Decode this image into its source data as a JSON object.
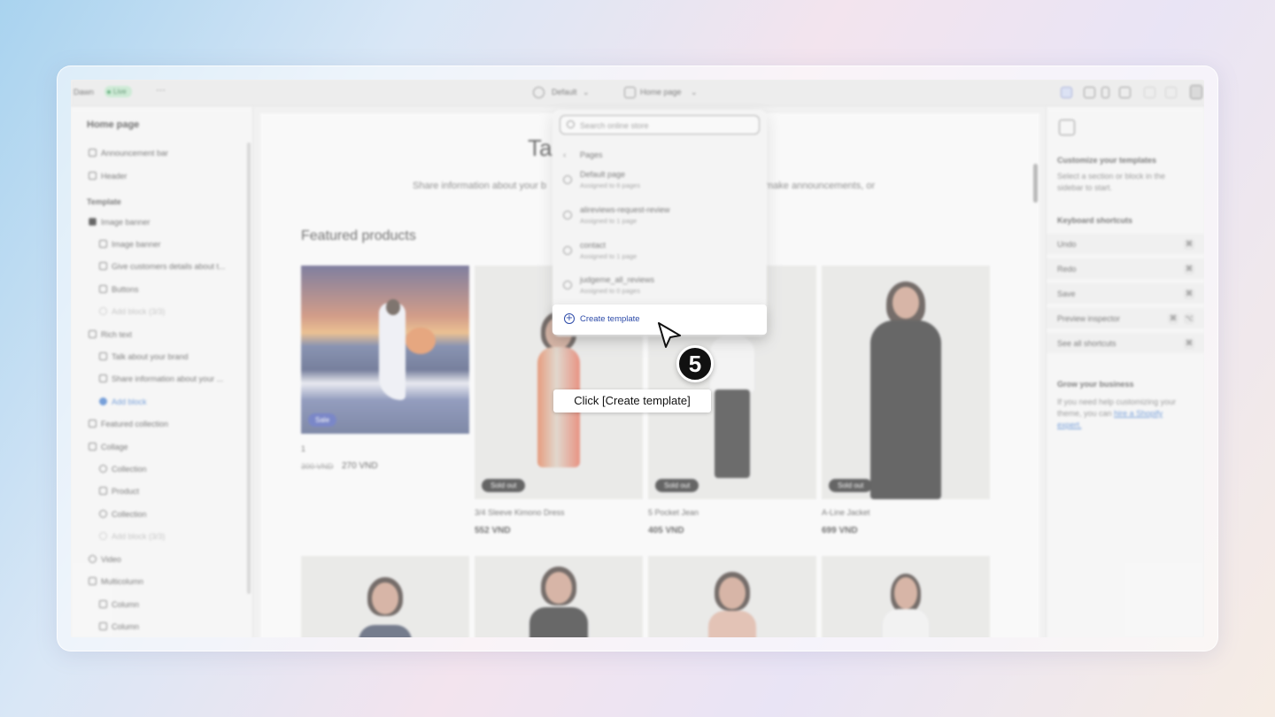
{
  "topbar": {
    "store_name": "Dawn",
    "status_badge": "Live",
    "more_label": "···",
    "theme_select": "Default",
    "page_select": "Home page"
  },
  "sidebar": {
    "title": "Home page",
    "items": [
      {
        "label": "Announcement bar",
        "icon": "section-icon"
      },
      {
        "label": "Header",
        "icon": "section-icon"
      },
      {
        "label": "Template",
        "icon": ""
      },
      {
        "label": "Image banner",
        "icon": "image-icon"
      },
      {
        "label": "Image banner",
        "icon": "text-icon"
      },
      {
        "label": "Give customers details about t...",
        "icon": "text-icon"
      },
      {
        "label": "Buttons",
        "icon": "buttons-icon"
      },
      {
        "label": "Add block (3/3)",
        "icon": "plus-icon"
      },
      {
        "label": "Rich text",
        "icon": "section-icon"
      },
      {
        "label": "Talk about your brand",
        "icon": "text-icon"
      },
      {
        "label": "Share information about your ...",
        "icon": "text-icon"
      },
      {
        "label": "Add block",
        "icon": "plus-icon"
      },
      {
        "label": "Featured collection",
        "icon": "section-icon"
      },
      {
        "label": "Collage",
        "icon": "section-icon"
      },
      {
        "label": "Collection",
        "icon": "collection-icon"
      },
      {
        "label": "Product",
        "icon": "tag-icon"
      },
      {
        "label": "Collection",
        "icon": "collection-icon"
      },
      {
        "label": "Add block (3/3)",
        "icon": "plus-icon"
      },
      {
        "label": "Video",
        "icon": "play-icon"
      },
      {
        "label": "Multicolumn",
        "icon": "section-icon"
      },
      {
        "label": "Column",
        "icon": "column-icon"
      },
      {
        "label": "Column",
        "icon": "column-icon"
      }
    ]
  },
  "preview": {
    "title_fragment": "Ta",
    "desc_left": "Share information about your b",
    "desc_right": "make announcements, or",
    "featured_heading": "Featured products",
    "first_product": {
      "badge": "Sale",
      "name": "1",
      "old_price": "300 VND",
      "price": "270 VND"
    },
    "products": [
      {
        "name": "3/4 Sleeve Kimono Dress",
        "price": "552 VND",
        "badge": "Sold out"
      },
      {
        "name": "5 Pocket Jean",
        "price": "405 VND",
        "badge": "Sold out"
      },
      {
        "name": "A-Line Jacket",
        "price": "699 VND",
        "badge": "Sold out"
      }
    ]
  },
  "dropdown": {
    "search_placeholder": "Search online store",
    "back_label": "‹",
    "section": "Pages",
    "pages": [
      {
        "name": "Default page",
        "sub": "Assigned to 6 pages"
      },
      {
        "name": "alireviews-request-review",
        "sub": "Assigned to 1 page"
      },
      {
        "name": "contact",
        "sub": "Assigned to 1 page"
      },
      {
        "name": "judgeme_all_reviews",
        "sub": "Assigned to 0 pages"
      }
    ],
    "create_label": "Create template"
  },
  "right_panel": {
    "title": "Customize your templates",
    "desc1": "Select a section or block in the",
    "desc2": "sidebar to start.",
    "shortcuts_heading": "Keyboard shortcuts",
    "shortcuts": [
      "Undo",
      "Redo",
      "Save",
      "Preview inspector",
      "See all shortcuts"
    ],
    "grow_heading": "Grow your business",
    "grow1": "If you need help customizing your",
    "grow2": "theme, you can",
    "grow_link": "hire a Shopify",
    "grow3": "expert."
  },
  "overlay": {
    "step_number": "5",
    "tooltip": "Click [Create template]"
  },
  "colors": {
    "accent": "#2c4aa8",
    "live_green": "#b8e6c5",
    "sale_blue": "#3347b0"
  }
}
